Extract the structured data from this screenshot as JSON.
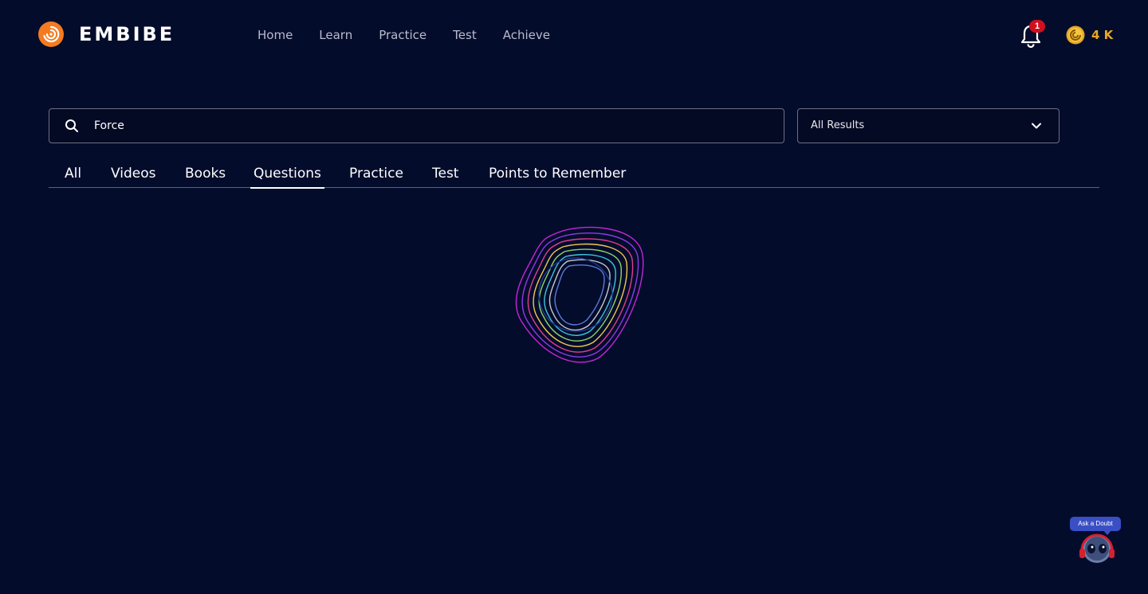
{
  "header": {
    "logo_text": "EMBIBE",
    "nav": [
      "Home",
      "Learn",
      "Practice",
      "Test",
      "Achieve"
    ],
    "notification_count": "1",
    "coins": "4 K"
  },
  "search": {
    "value": "Force",
    "filter_label": "All Results"
  },
  "tabs": [
    {
      "label": "All"
    },
    {
      "label": "Videos"
    },
    {
      "label": "Books"
    },
    {
      "label": "Questions",
      "active": true
    },
    {
      "label": "Practice"
    },
    {
      "label": "Test"
    },
    {
      "label": "Points to Remember"
    }
  ],
  "ask_doubt": {
    "label": "Ask a Doubt"
  },
  "colors": {
    "background": "#040c2c",
    "coin_text": "#e7a724",
    "badge": "#d0101e",
    "logo": "#f47b20"
  }
}
